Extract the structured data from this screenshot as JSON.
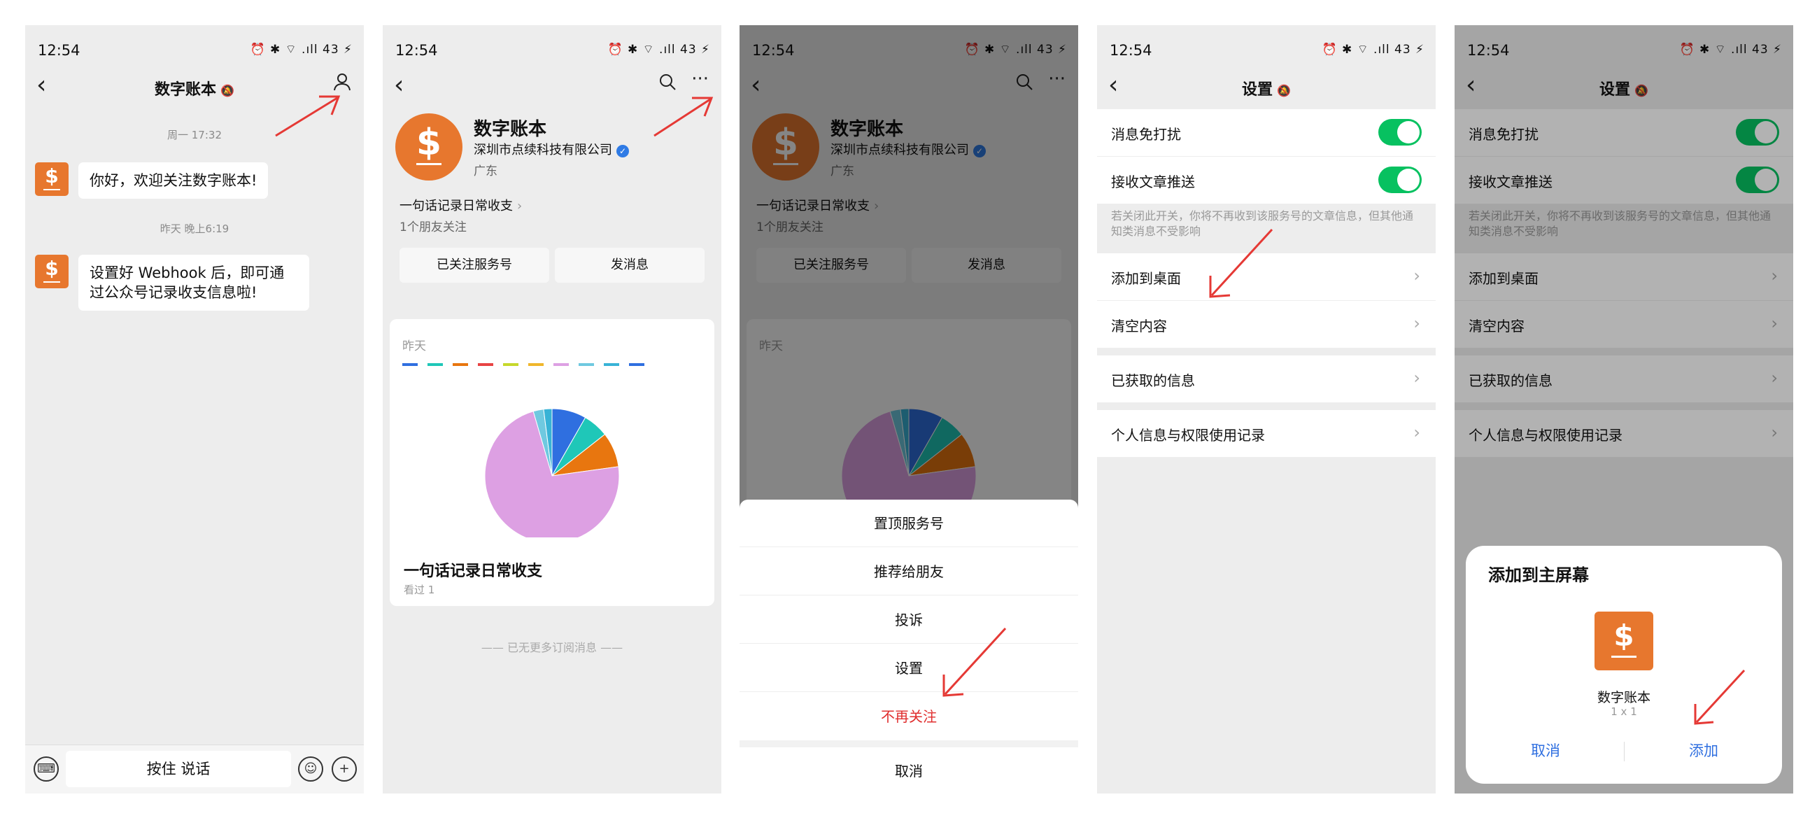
{
  "status": {
    "time": "12:54",
    "icons": "⏰ ✱ ⌔ .ıll 43 ⚡"
  },
  "back_glyph": "‹",
  "p1": {
    "title": "数字账本",
    "mute_icon": "🔕",
    "ts1": "周一 17:32",
    "msg1": "你好，欢迎关注数字账本!",
    "ts2": "昨天 晚上6:19",
    "msg2": "设置好 Webhook 后，即可通过公众号记录收支信息啦!",
    "avatar_glyph": "$",
    "voice_label": "按住 说话",
    "keyboard_glyph": "⌨",
    "emoji_glyph": "☺",
    "plus_glyph": "+"
  },
  "p2": {
    "name": "数字账本",
    "company": "深圳市点续科技有限公司",
    "verified_glyph": "✓",
    "region": "广东",
    "desc": "一句话记录日常收支",
    "desc_chevron": "›",
    "friends": "1个朋友关注",
    "btn_followed": "已关注服务号",
    "btn_message": "发消息",
    "article_date": "昨天",
    "article_title": "一句话记录日常收支",
    "article_views": "看过 1",
    "no_more": "—— 已无更多订阅消息 ——"
  },
  "p3": {
    "sheet_items": [
      "置顶服务号",
      "推荐给朋友",
      "投诉",
      "设置",
      "不再关注"
    ],
    "cancel": "取消"
  },
  "p4": {
    "title": "设置",
    "dnd": "消息免打扰",
    "receive": "接收文章推送",
    "hint": "若关闭此开关，你将不再收到该服务号的文章信息，但其他通知类消息不受影响",
    "add_desktop": "添加到桌面",
    "clear": "清空内容",
    "obtained": "已获取的信息",
    "privacy": "个人信息与权限使用记录",
    "chevron": "›"
  },
  "p5": {
    "dialog_title": "添加到主屏幕",
    "app_name": "数字账本",
    "size": "1 x 1",
    "cancel": "取消",
    "add": "添加"
  },
  "chart_data": {
    "type": "pie",
    "title": "",
    "series": [
      {
        "value": 8700,
        "color": "#dda0e3"
      },
      {
        "value": 1005,
        "color": "#e8760f"
      },
      {
        "value": 735,
        "color": "#1fc7b8"
      },
      {
        "value": 990,
        "color": "#2f6fe0"
      },
      {
        "value": 240,
        "color": "#38b3d6"
      },
      {
        "value": 300,
        "color": "#6fc9e0"
      }
    ],
    "legend_colors": [
      "#2f6fe0",
      "#1fc7b8",
      "#e8760f",
      "#e84343",
      "#c6d82b",
      "#f0b62b",
      "#dda0e3",
      "#6fc9e0",
      "#38b3d6",
      "#2f6fe0"
    ]
  },
  "colors": {
    "accent_green": "#07c160",
    "brand_orange": "#e7772e",
    "danger_red": "#e02e2e",
    "link_blue": "#2f6fe0",
    "arrow_red": "#e53935"
  }
}
